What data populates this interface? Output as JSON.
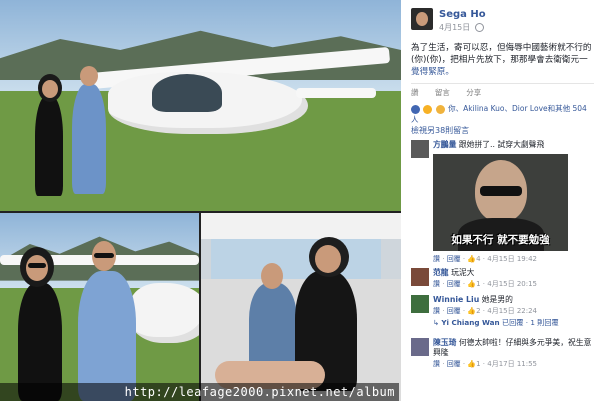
{
  "post": {
    "author": "Sega Ho",
    "date": "4月15日",
    "text": "為了生活，寄可以忍，但侮辱中國藝術就不行的(你)(你)，把相片先放下，那那學會去衛衛元一",
    "see_translation": "覺得緊原。"
  },
  "actions": {
    "like": "讚",
    "comment": "留言",
    "share": "分享"
  },
  "reactions": {
    "summary": "你、Akilina Kuo、Dior Love和其他 504 人"
  },
  "comments_header": "檢視另38則留言",
  "comments": [
    {
      "name": "方鵬量",
      "text": "跟她拼了.. 試穿大劇聲飛",
      "meme_caption": "如果不行 就不要勉強",
      "like_label": "讚",
      "reply_label": "回覆",
      "likes": "4",
      "time": "4月15日 19:42"
    },
    {
      "name": "范龍",
      "text": "玩泥大",
      "like_label": "讚",
      "reply_label": "回覆",
      "likes": "1",
      "time": "4月15日 20:15"
    },
    {
      "name": "Winnie Liu",
      "text": "她是男的",
      "like_label": "讚",
      "reply_label": "回覆",
      "likes": "2",
      "time": "4月15日 22:24",
      "reply_author": "Yi Chiang Wan",
      "reply_text": "已回覆 · 1 則回覆"
    },
    {
      "name": "陳玉琦",
      "text": "何德太帥啦！仔細與多元爭美，祝生意興隆",
      "like_label": "讚",
      "reply_label": "回覆",
      "likes": "1",
      "time": "4月17日 11:55"
    }
  ],
  "watermark": "http://leafage2000.pixnet.net/album",
  "colors": {
    "link": "#365899",
    "meta": "#90949c",
    "grass": "#6f9a45",
    "sky": "#8fb4d8"
  }
}
